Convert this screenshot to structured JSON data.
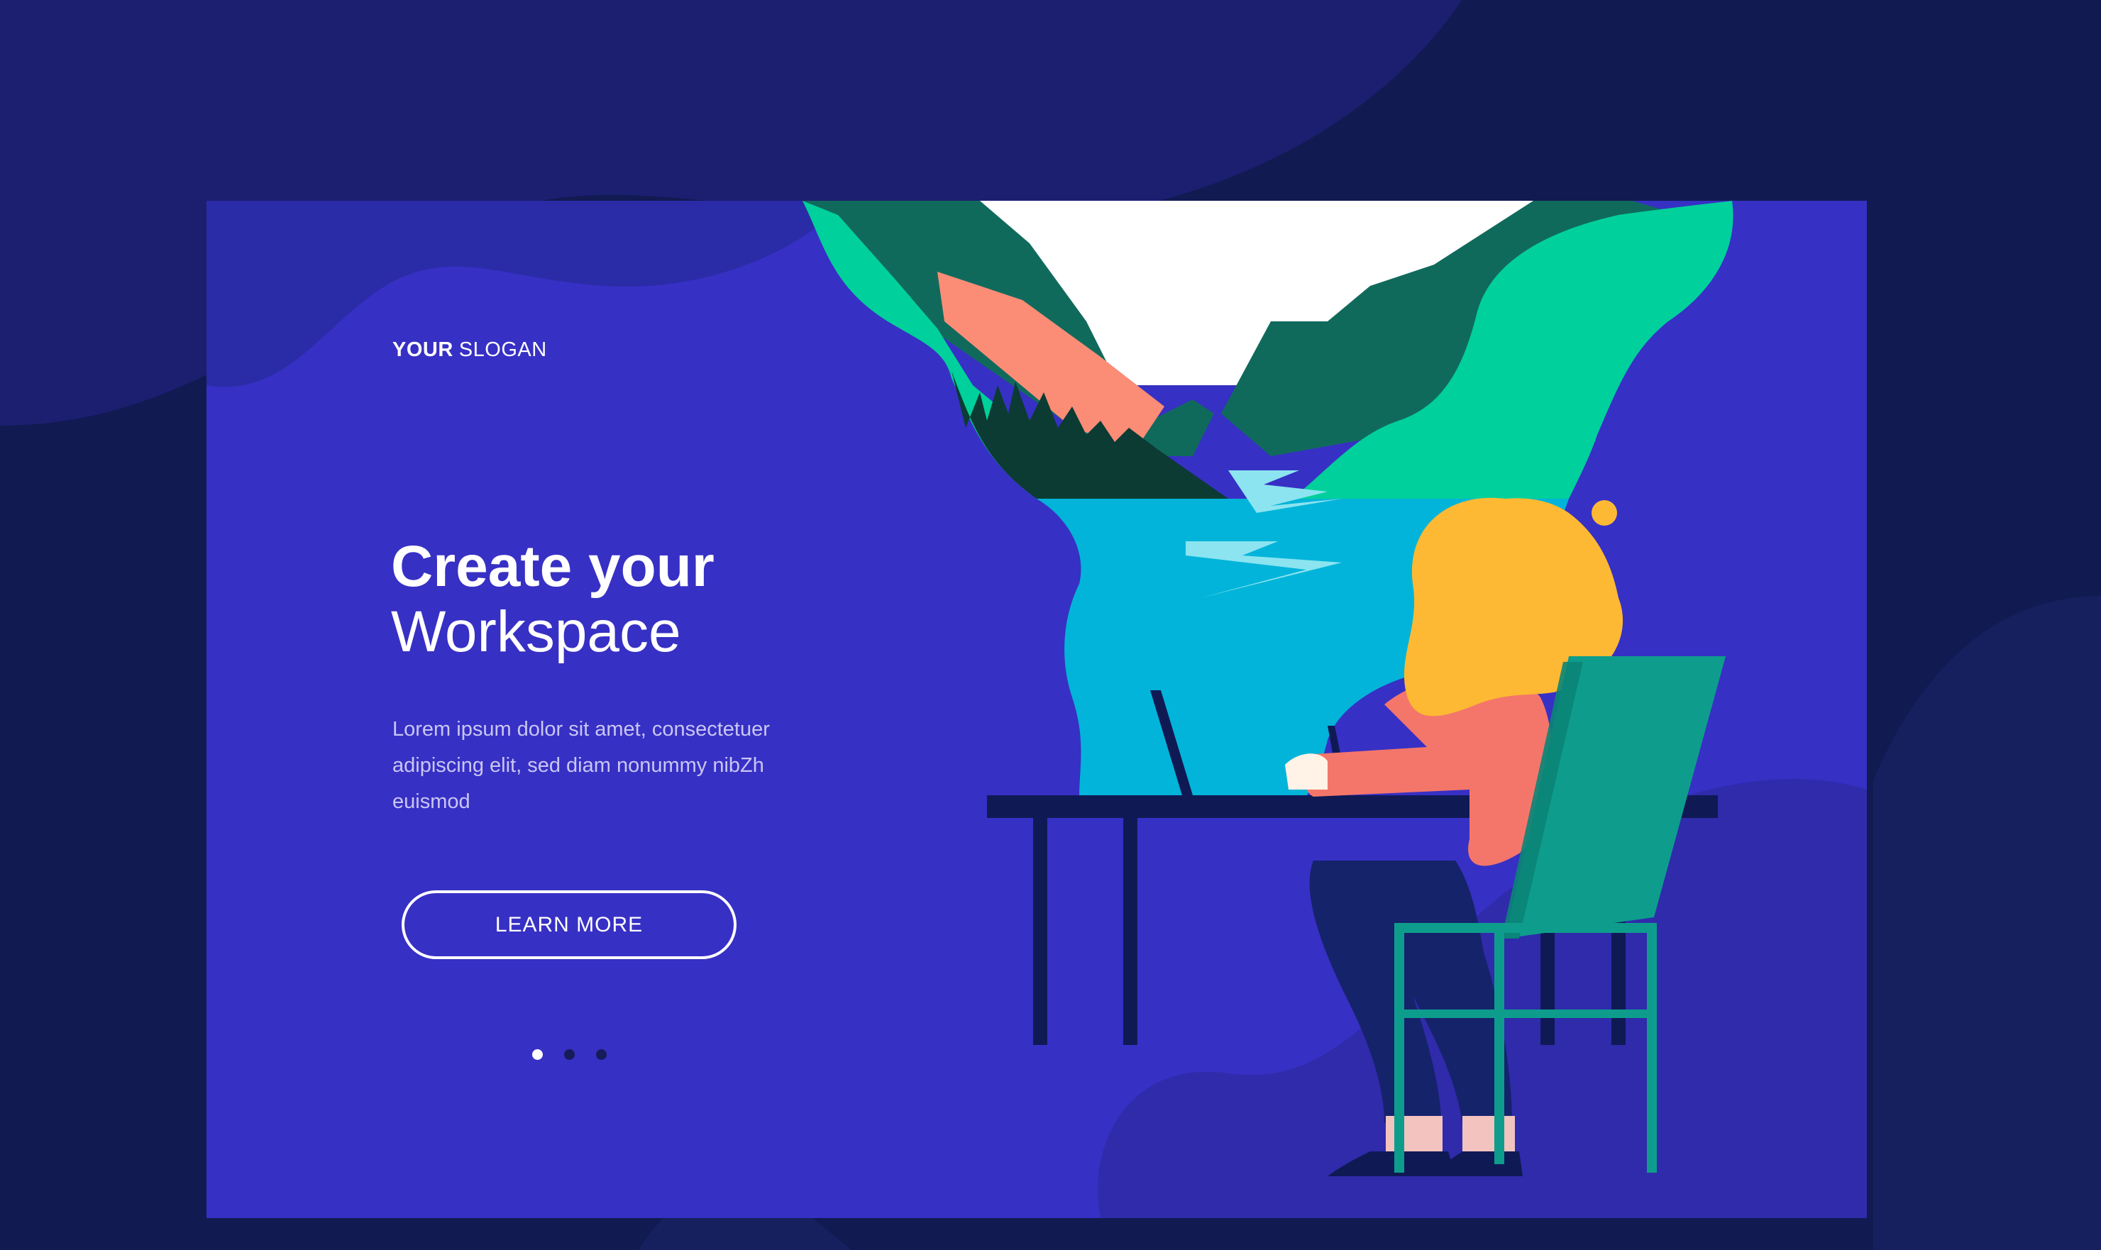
{
  "hero": {
    "slogan_bold": "YOUR",
    "slogan_light": "SLOGAN",
    "title_line1": "Create your",
    "title_line2": "Workspace",
    "body": "Lorem ipsum dolor sit amet, consectetuer adipiscing elit, sed diam nonummy nibZh euismod",
    "cta_label": "LEARN MORE"
  },
  "carousel": {
    "slide_count": 3,
    "active_index": 0
  },
  "colors": {
    "page_bg": "#121a52",
    "card_bg": "#3730c4",
    "hair": "#fdb934",
    "shirt": "#f4766a",
    "chair": "#0e9d8c",
    "water": "#02b4d9",
    "forest": "#00d09c"
  },
  "icons": [
    "illustration-landscape",
    "illustration-woman-at-desk"
  ]
}
